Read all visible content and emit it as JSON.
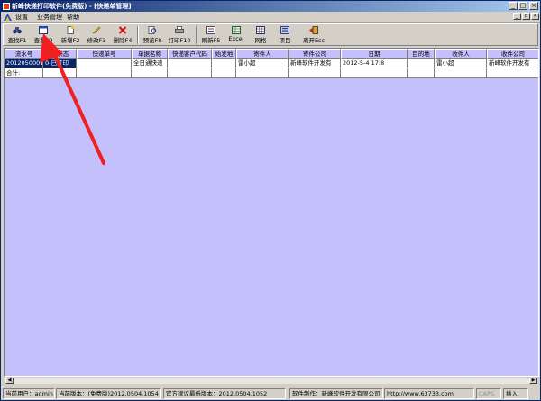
{
  "window": {
    "title": "新峰快递打印软件(免费版) - [快递单管理]",
    "controls": {
      "minimize": "_",
      "maximize": "□",
      "close": "×"
    },
    "mdi_controls": {
      "minimize": "_",
      "restore": "▫",
      "close": "×"
    }
  },
  "menu": {
    "items": [
      {
        "label": "设置"
      },
      {
        "label": "业务管理"
      },
      {
        "label": "帮助"
      }
    ]
  },
  "toolbar": {
    "buttons": [
      {
        "label": "查找F1",
        "icon": "binoculars-icon"
      },
      {
        "label": "查看F9",
        "icon": "view-window-icon"
      },
      {
        "label": "新增F2",
        "icon": "new-document-icon"
      },
      {
        "label": "修改F3",
        "icon": "edit-pencil-icon"
      },
      {
        "label": "删除F4",
        "icon": "delete-x-icon"
      },
      {
        "label": "预览F8",
        "icon": "preview-icon"
      },
      {
        "label": "打印F10",
        "icon": "printer-icon"
      },
      {
        "label": "刷新F5",
        "icon": "refresh-icon"
      },
      {
        "label": "Excel",
        "icon": "excel-icon"
      },
      {
        "label": "网格",
        "icon": "grid-icon"
      },
      {
        "label": "项目",
        "icon": "project-icon"
      },
      {
        "label": "离开Esc",
        "icon": "exit-door-icon"
      }
    ]
  },
  "table": {
    "columns": [
      "流水号",
      "发状态",
      "快递单号",
      "单据名称",
      "快递客户代码",
      "始发地",
      "寄件人",
      "寄件公司",
      "日期",
      "目的地",
      "收件人",
      "收件公司"
    ],
    "rows": [
      [
        "2012050001",
        "0-已打印",
        "",
        "全日通快递",
        "",
        "",
        "雷小超",
        "新峰软件开发有",
        "2012-5-4 17:8",
        "",
        "雷小超",
        "新峰软件开发有"
      ]
    ],
    "total_label": "合计:"
  },
  "status": {
    "current_user": "当前用户：admin",
    "current_version": "当前版本：(免费版)2012.0504.1054",
    "recommended_version": "官方建议最低版本：2012.0504.1052",
    "producer": "软件制作：新峰软件开发有限公司",
    "website": "http://www.63733.com",
    "caps": "CAPS",
    "mode": "插入"
  },
  "colors": {
    "grid_background": "#c4c0fc",
    "selection": "#0a246a",
    "annotation_arrow": "#f02020"
  }
}
